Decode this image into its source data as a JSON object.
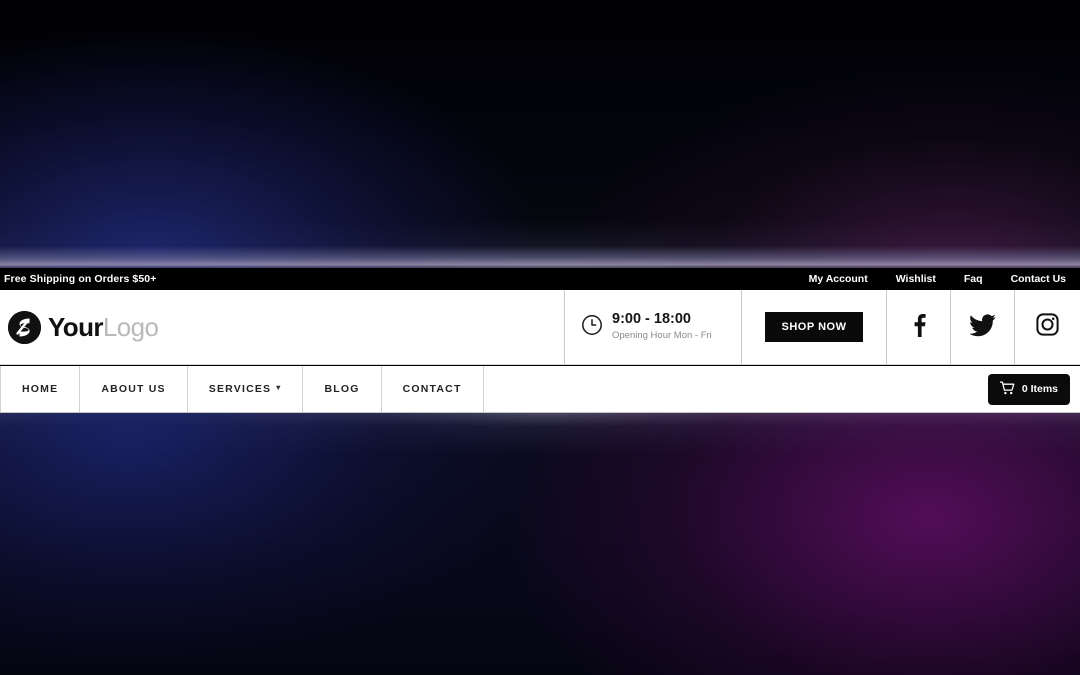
{
  "topbar": {
    "promo": "Free Shipping on Orders $50+",
    "links": [
      {
        "label": "My Account"
      },
      {
        "label": "Wishlist"
      },
      {
        "label": "Faq"
      },
      {
        "label": "Contact Us"
      }
    ]
  },
  "header": {
    "logo": {
      "icon": "lightning-circle-logo-icon",
      "text_bold": "Your",
      "text_light": "Logo"
    },
    "hours": {
      "icon": "clock-icon",
      "time": "9:00 - 18:00",
      "subtitle": "Opening Hour Mon - Fri"
    },
    "shop_button": {
      "label": "SHOP NOW"
    },
    "social": [
      {
        "name": "facebook-icon",
        "label": "Facebook"
      },
      {
        "name": "twitter-icon",
        "label": "Twitter"
      },
      {
        "name": "instagram-icon",
        "label": "Instagram"
      }
    ]
  },
  "nav": {
    "items": [
      {
        "label": "HOME",
        "has_dropdown": false
      },
      {
        "label": "ABOUT US",
        "has_dropdown": false
      },
      {
        "label": "SERVICES",
        "has_dropdown": true,
        "caret": "▾"
      },
      {
        "label": "BLOG",
        "has_dropdown": false
      },
      {
        "label": "CONTACT",
        "has_dropdown": false
      }
    ],
    "cart": {
      "icon": "shopping-cart-icon",
      "label": "0 Items"
    }
  },
  "colors": {
    "bar_black": "#000000",
    "header_white": "#ffffff",
    "accent_dark": "#0a0a0a",
    "muted_text": "#8a8a8a",
    "logo_light": "#b9b9b9"
  }
}
